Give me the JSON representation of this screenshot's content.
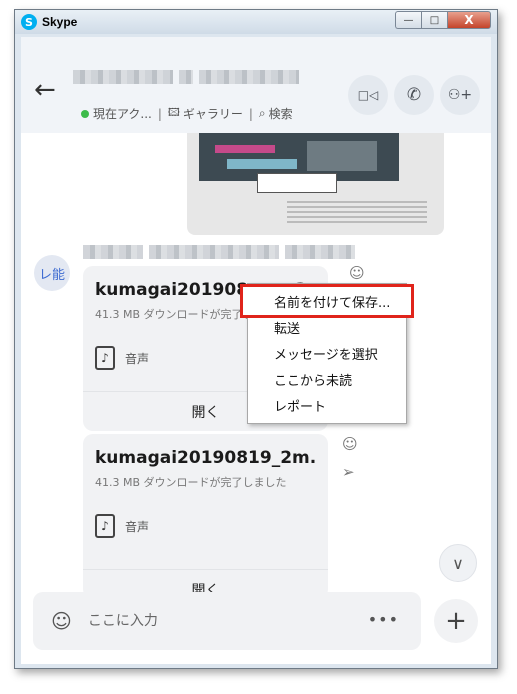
{
  "window": {
    "title": "Skype",
    "app_icon_letter": "S",
    "controls": {
      "minimize": "—",
      "maximize": "□",
      "close": "X"
    }
  },
  "header": {
    "back_icon": "←",
    "status_text": "現在アク...",
    "gallery_label": "ギャラリー",
    "search_label": "検索",
    "video_icon": "□◁",
    "call_icon": "✆",
    "add_people_icon": "⚇+"
  },
  "sender": {
    "avatar_initials": "レ能"
  },
  "messages": [
    {
      "file_name": "kumagai201908… .m3",
      "status": "41.3 MB ダウンロードが完了しました",
      "type_label": "音声",
      "open_label": "開く"
    },
    {
      "file_name": "kumagai20190819_2m...",
      "status": "41.3 MB ダウンロードが完了しました",
      "type_label": "音声",
      "open_label": "開く"
    }
  ],
  "context_menu": {
    "items": [
      "名前を付けて保存...",
      "転送",
      "メッセージを選択",
      "ここから未読",
      "レポート"
    ]
  },
  "composer": {
    "placeholder": "ここに入力",
    "more_label": "•••",
    "plus_label": "+",
    "emoji_icon": "☺"
  },
  "colors": {
    "online": "#3dbb4a",
    "highlight_border": "#e0241b",
    "accent": "#00aff0"
  }
}
